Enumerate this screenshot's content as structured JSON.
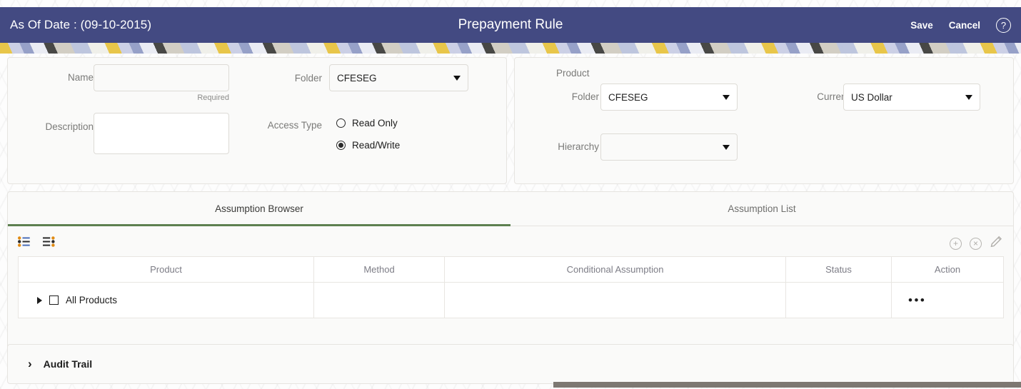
{
  "header": {
    "as_of_date_label": "As Of Date : (09-10-2015)",
    "title": "Prepayment Rule",
    "save_label": "Save",
    "cancel_label": "Cancel",
    "help_glyph": "?",
    "background_color": "#434a82"
  },
  "form": {
    "name_label": "Name",
    "name_value": "",
    "name_hint": "Required",
    "description_label": "Description",
    "description_value": "",
    "folder_label": "Folder",
    "folder_value": "CFESEG",
    "access_type_label": "Access Type",
    "access_options": [
      {
        "label": "Read Only",
        "selected": false
      },
      {
        "label": "Read/Write",
        "selected": true
      }
    ]
  },
  "product": {
    "section_label": "Product",
    "folder_label": "Folder",
    "folder_value": "CFESEG",
    "hierarchy_label": "Hierarchy",
    "hierarchy_value": "",
    "currency_label": "Currency",
    "currency_value": "US Dollar"
  },
  "tabs": [
    {
      "label": "Assumption Browser",
      "active": true
    },
    {
      "label": "Assumption List",
      "active": false
    }
  ],
  "grid_toolbar": {
    "left_icons": [
      "list-bullets-icon",
      "list-reverse-bullets-icon"
    ],
    "right_icons": [
      {
        "name": "add-icon",
        "glyph": "+"
      },
      {
        "name": "delete-icon",
        "glyph": "×"
      },
      {
        "name": "edit-icon",
        "glyph": "✎"
      }
    ]
  },
  "table": {
    "columns": [
      "Product",
      "Method",
      "Conditional Assumption",
      "Status",
      "Action"
    ],
    "rows": [
      {
        "product": "All Products",
        "checked": false,
        "expanded": false,
        "method": "",
        "conditional_assumption": "",
        "status": "",
        "action_glyph": "•••"
      }
    ]
  },
  "audit": {
    "chevron": "›",
    "title": "Audit Trail",
    "expanded": false
  },
  "accent_colors": {
    "active_tab_underline": "#5d8050",
    "header": "#434a82"
  }
}
